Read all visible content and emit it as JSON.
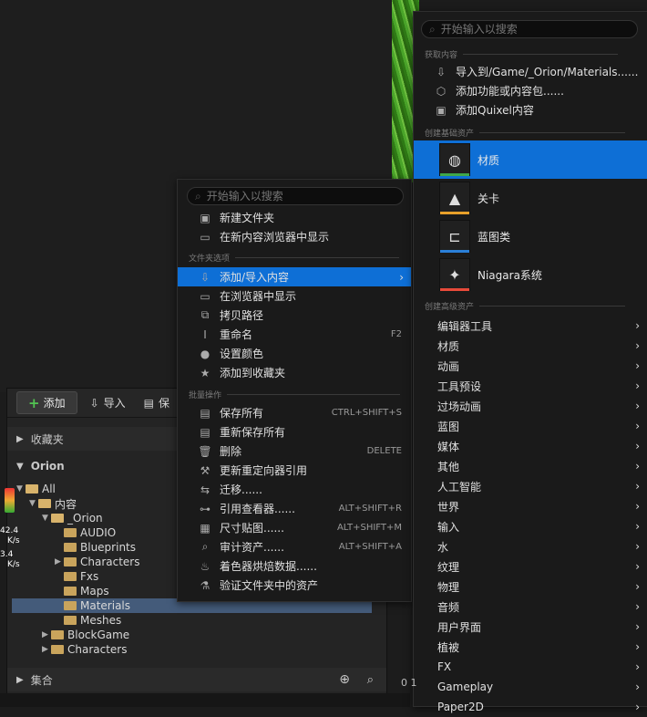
{
  "left_menu": {
    "search_placeholder": "开始输入以搜索",
    "items_top": [
      {
        "label": "新建文件夹",
        "icon": "new-folder-icon"
      },
      {
        "label": "在新内容浏览器中显示",
        "icon": "browser-icon"
      }
    ],
    "section_folder": "文件夹选项",
    "items_folder": [
      {
        "label": "添加/导入内容",
        "icon": "import-icon",
        "submenu": true
      },
      {
        "label": "在浏览器中显示",
        "icon": "browser-icon"
      },
      {
        "label": "拷贝路径",
        "icon": "copy-path-icon"
      },
      {
        "label": "重命名",
        "icon": "rename-icon",
        "shortcut": "F2"
      },
      {
        "label": "设置颜色",
        "icon": "color-icon"
      },
      {
        "label": "添加到收藏夹",
        "icon": "star-icon"
      }
    ],
    "section_bulk": "批量操作",
    "items_bulk": [
      {
        "label": "保存所有",
        "icon": "save-icon",
        "shortcut": "CTRL+SHIFT+S"
      },
      {
        "label": "重新保存所有",
        "icon": "save-icon"
      },
      {
        "label": "删除",
        "icon": "trash-icon",
        "shortcut": "DELETE"
      },
      {
        "label": "更新重定向器引用",
        "icon": "wrench-icon"
      },
      {
        "label": "迁移......",
        "icon": "migrate-icon"
      },
      {
        "label": "引用查看器......",
        "icon": "reference-icon",
        "shortcut": "ALT+SHIFT+R"
      },
      {
        "label": "尺寸贴图......",
        "icon": "size-map-icon",
        "shortcut": "ALT+SHIFT+M"
      },
      {
        "label": "审计资产......",
        "icon": "audit-icon",
        "shortcut": "ALT+SHIFT+A"
      },
      {
        "label": "着色器烘焙数据......",
        "icon": "shader-icon"
      },
      {
        "label": "验证文件夹中的资产",
        "icon": "validate-icon"
      }
    ]
  },
  "right_menu": {
    "search_placeholder": "开始输入以搜索",
    "section_get": "获取内容",
    "items_get": [
      {
        "label": "导入到/Game/_Orion/Materials......",
        "icon": "import-icon"
      },
      {
        "label": "添加功能或内容包......",
        "icon": "package-icon"
      },
      {
        "label": "添加Quixel内容",
        "icon": "quixel-icon"
      }
    ],
    "section_basic": "创建基础资产",
    "assets": [
      {
        "label": "材质",
        "icon": "material-icon",
        "bar_color": "#3fa84a"
      },
      {
        "label": "关卡",
        "icon": "level-icon",
        "bar_color": "#e8a02a"
      },
      {
        "label": "蓝图类",
        "icon": "blueprint-icon",
        "bar_color": "#2a7fd8"
      },
      {
        "label": "Niagara系统",
        "icon": "niagara-icon",
        "bar_color": "#e84a3a"
      }
    ],
    "section_advanced": "创建高级资产",
    "advanced": [
      "编辑器工具",
      "材质",
      "动画",
      "工具预设",
      "过场动画",
      "蓝图",
      "媒体",
      "其他",
      "人工智能",
      "世界",
      "输入",
      "水",
      "纹理",
      "物理",
      "音频",
      "用户界面",
      "植被",
      "FX",
      "Gameplay",
      "Paper2D"
    ]
  },
  "content_browser": {
    "add_label": "添加",
    "import_label": "导入",
    "save_partial": "保",
    "favorites_label": "收藏夹",
    "root_label": "Orion",
    "collections_label": "集合",
    "tree": [
      {
        "label": "All",
        "depth": 0,
        "open": true
      },
      {
        "label": "内容",
        "depth": 1,
        "open": true
      },
      {
        "label": "_Orion",
        "depth": 2,
        "open": true
      },
      {
        "label": "AUDIO",
        "depth": 3
      },
      {
        "label": "Blueprints",
        "depth": 3
      },
      {
        "label": "Characters",
        "depth": 3,
        "expandable": true
      },
      {
        "label": "Fxs",
        "depth": 3
      },
      {
        "label": "Maps",
        "depth": 3
      },
      {
        "label": "Materials",
        "depth": 3,
        "selected": true
      },
      {
        "label": "Meshes",
        "depth": 3
      },
      {
        "label": "BlockGame",
        "depth": 2,
        "expandable": true
      },
      {
        "label": "Characters",
        "depth": 2,
        "expandable": true
      }
    ]
  },
  "stats": {
    "a": "42.4",
    "a_unit": "K/s",
    "b": "3.4",
    "b_unit": "K/s"
  },
  "bottom_partial": "0 1"
}
